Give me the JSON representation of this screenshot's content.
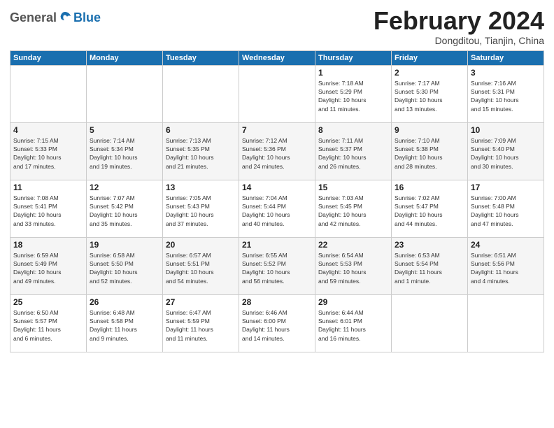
{
  "header": {
    "logo_general": "General",
    "logo_blue": "Blue",
    "month_title": "February 2024",
    "location": "Dongditou, Tianjin, China"
  },
  "weekdays": [
    "Sunday",
    "Monday",
    "Tuesday",
    "Wednesday",
    "Thursday",
    "Friday",
    "Saturday"
  ],
  "weeks": [
    [
      {
        "day": "",
        "info": ""
      },
      {
        "day": "",
        "info": ""
      },
      {
        "day": "",
        "info": ""
      },
      {
        "day": "",
        "info": ""
      },
      {
        "day": "1",
        "info": "Sunrise: 7:18 AM\nSunset: 5:29 PM\nDaylight: 10 hours\nand 11 minutes."
      },
      {
        "day": "2",
        "info": "Sunrise: 7:17 AM\nSunset: 5:30 PM\nDaylight: 10 hours\nand 13 minutes."
      },
      {
        "day": "3",
        "info": "Sunrise: 7:16 AM\nSunset: 5:31 PM\nDaylight: 10 hours\nand 15 minutes."
      }
    ],
    [
      {
        "day": "4",
        "info": "Sunrise: 7:15 AM\nSunset: 5:33 PM\nDaylight: 10 hours\nand 17 minutes."
      },
      {
        "day": "5",
        "info": "Sunrise: 7:14 AM\nSunset: 5:34 PM\nDaylight: 10 hours\nand 19 minutes."
      },
      {
        "day": "6",
        "info": "Sunrise: 7:13 AM\nSunset: 5:35 PM\nDaylight: 10 hours\nand 21 minutes."
      },
      {
        "day": "7",
        "info": "Sunrise: 7:12 AM\nSunset: 5:36 PM\nDaylight: 10 hours\nand 24 minutes."
      },
      {
        "day": "8",
        "info": "Sunrise: 7:11 AM\nSunset: 5:37 PM\nDaylight: 10 hours\nand 26 minutes."
      },
      {
        "day": "9",
        "info": "Sunrise: 7:10 AM\nSunset: 5:38 PM\nDaylight: 10 hours\nand 28 minutes."
      },
      {
        "day": "10",
        "info": "Sunrise: 7:09 AM\nSunset: 5:40 PM\nDaylight: 10 hours\nand 30 minutes."
      }
    ],
    [
      {
        "day": "11",
        "info": "Sunrise: 7:08 AM\nSunset: 5:41 PM\nDaylight: 10 hours\nand 33 minutes."
      },
      {
        "day": "12",
        "info": "Sunrise: 7:07 AM\nSunset: 5:42 PM\nDaylight: 10 hours\nand 35 minutes."
      },
      {
        "day": "13",
        "info": "Sunrise: 7:05 AM\nSunset: 5:43 PM\nDaylight: 10 hours\nand 37 minutes."
      },
      {
        "day": "14",
        "info": "Sunrise: 7:04 AM\nSunset: 5:44 PM\nDaylight: 10 hours\nand 40 minutes."
      },
      {
        "day": "15",
        "info": "Sunrise: 7:03 AM\nSunset: 5:45 PM\nDaylight: 10 hours\nand 42 minutes."
      },
      {
        "day": "16",
        "info": "Sunrise: 7:02 AM\nSunset: 5:47 PM\nDaylight: 10 hours\nand 44 minutes."
      },
      {
        "day": "17",
        "info": "Sunrise: 7:00 AM\nSunset: 5:48 PM\nDaylight: 10 hours\nand 47 minutes."
      }
    ],
    [
      {
        "day": "18",
        "info": "Sunrise: 6:59 AM\nSunset: 5:49 PM\nDaylight: 10 hours\nand 49 minutes."
      },
      {
        "day": "19",
        "info": "Sunrise: 6:58 AM\nSunset: 5:50 PM\nDaylight: 10 hours\nand 52 minutes."
      },
      {
        "day": "20",
        "info": "Sunrise: 6:57 AM\nSunset: 5:51 PM\nDaylight: 10 hours\nand 54 minutes."
      },
      {
        "day": "21",
        "info": "Sunrise: 6:55 AM\nSunset: 5:52 PM\nDaylight: 10 hours\nand 56 minutes."
      },
      {
        "day": "22",
        "info": "Sunrise: 6:54 AM\nSunset: 5:53 PM\nDaylight: 10 hours\nand 59 minutes."
      },
      {
        "day": "23",
        "info": "Sunrise: 6:53 AM\nSunset: 5:54 PM\nDaylight: 11 hours\nand 1 minute."
      },
      {
        "day": "24",
        "info": "Sunrise: 6:51 AM\nSunset: 5:56 PM\nDaylight: 11 hours\nand 4 minutes."
      }
    ],
    [
      {
        "day": "25",
        "info": "Sunrise: 6:50 AM\nSunset: 5:57 PM\nDaylight: 11 hours\nand 6 minutes."
      },
      {
        "day": "26",
        "info": "Sunrise: 6:48 AM\nSunset: 5:58 PM\nDaylight: 11 hours\nand 9 minutes."
      },
      {
        "day": "27",
        "info": "Sunrise: 6:47 AM\nSunset: 5:59 PM\nDaylight: 11 hours\nand 11 minutes."
      },
      {
        "day": "28",
        "info": "Sunrise: 6:46 AM\nSunset: 6:00 PM\nDaylight: 11 hours\nand 14 minutes."
      },
      {
        "day": "29",
        "info": "Sunrise: 6:44 AM\nSunset: 6:01 PM\nDaylight: 11 hours\nand 16 minutes."
      },
      {
        "day": "",
        "info": ""
      },
      {
        "day": "",
        "info": ""
      }
    ]
  ]
}
